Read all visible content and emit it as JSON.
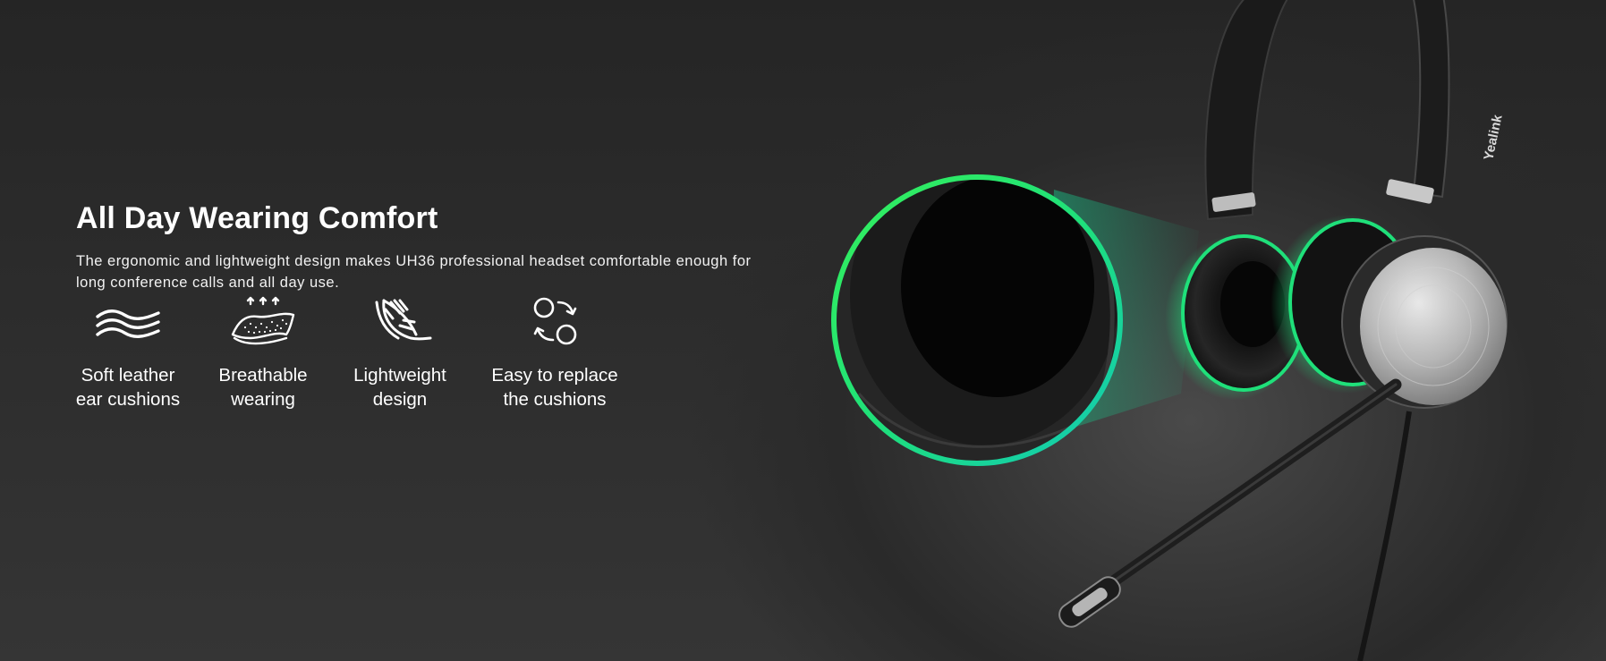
{
  "hero": {
    "title": "All Day Wearing Comfort",
    "description": "The ergonomic and lightweight design makes UH36 professional headset comfortable enough for long conference calls and all day use."
  },
  "features": [
    {
      "label": "Soft leather\near cushions",
      "icon": "waves-icon"
    },
    {
      "label": "Breathable\nwearing",
      "icon": "breathable-cushion-icon"
    },
    {
      "label": "Lightweight\ndesign",
      "icon": "feather-icon"
    },
    {
      "label": "Easy to replace\nthe cushions",
      "icon": "swap-circles-icon"
    }
  ],
  "product": {
    "brand_mark": "Yealink",
    "accent_color": "#1fe07a",
    "accent_color_2": "#12d3b0"
  }
}
